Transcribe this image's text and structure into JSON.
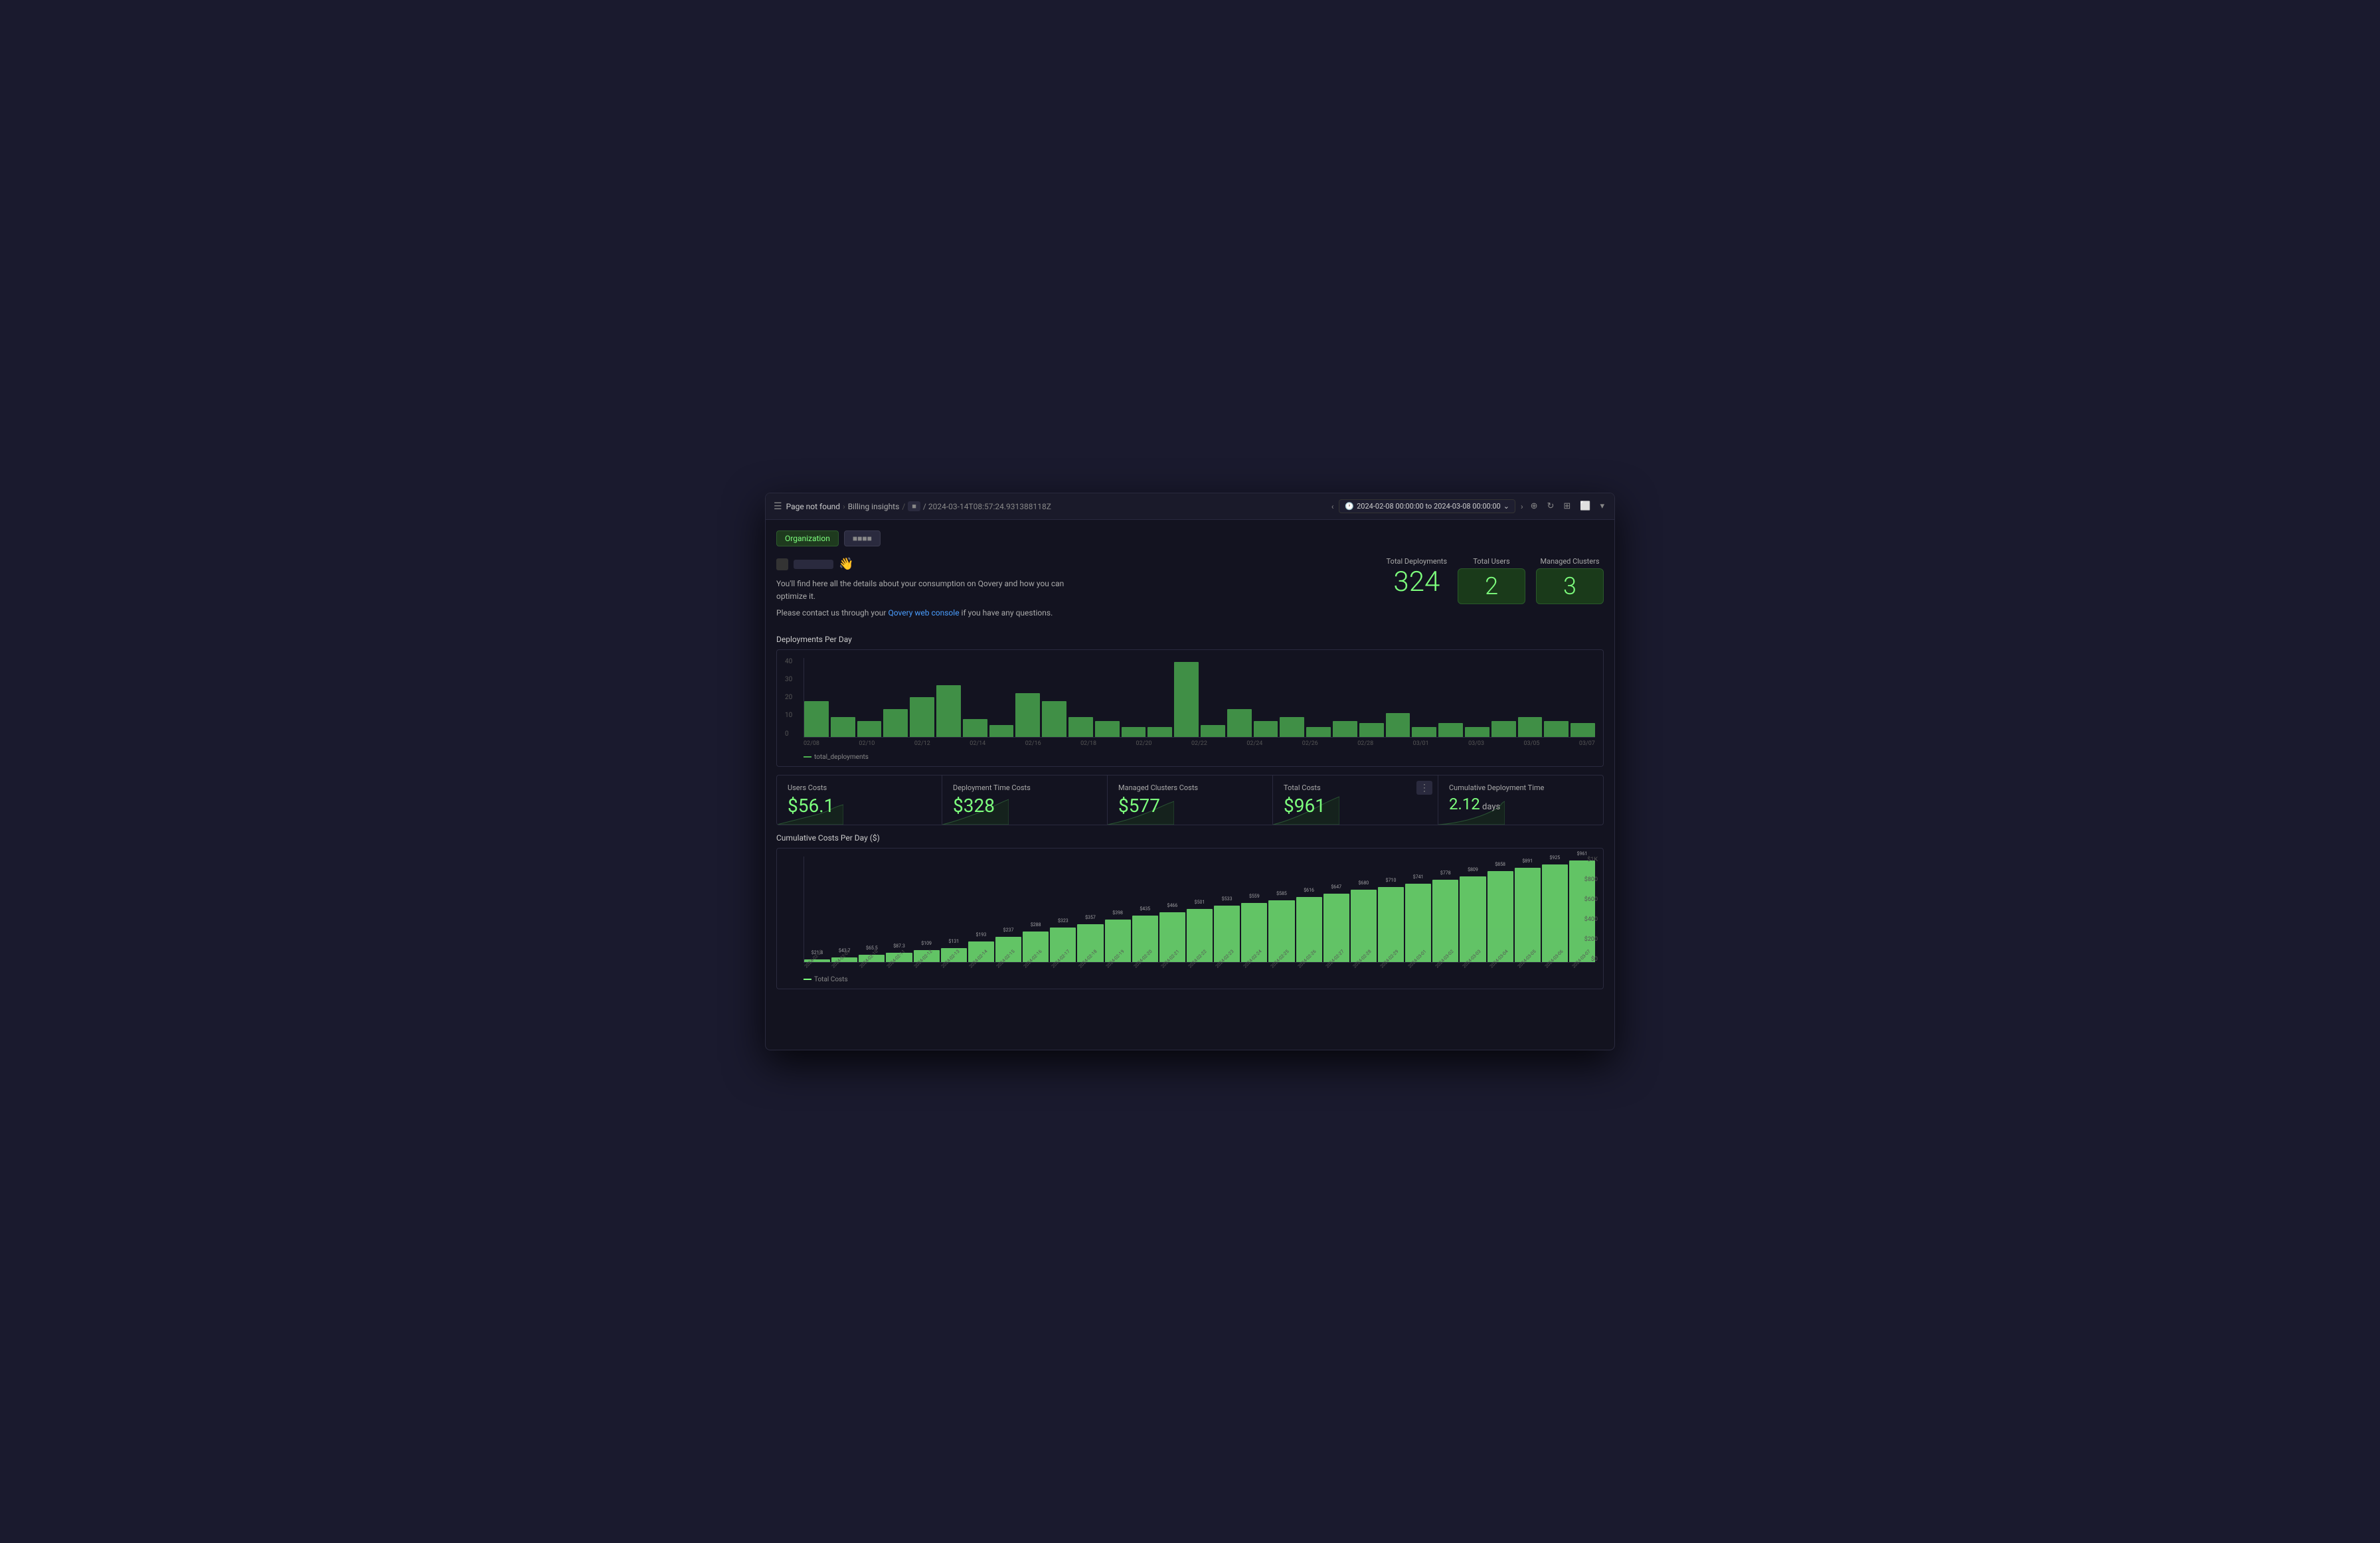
{
  "toolbar": {
    "hamburger_label": "☰",
    "breadcrumb": {
      "page": "Page not found",
      "sep1": "›",
      "billing": "Billing insights",
      "sep2": "/",
      "hash": "■",
      "path": "/ 2024-03-14T08:57:24.931388118Z"
    },
    "time_range": "2024-02-08 00:00:00 to 2024-03-08 00:00:00",
    "nav_prev": "‹",
    "nav_next": "›",
    "zoom_icon": "⊕",
    "refresh_icon": "↻",
    "expand_icon": "⊞",
    "dropdown_icon": "▾",
    "monitor_icon": "⬜",
    "more_icon": "⌄"
  },
  "tabs": [
    {
      "label": "Organization",
      "active": true
    },
    {
      "label": "■■■■",
      "active": false
    }
  ],
  "org": {
    "emoji": "👋",
    "description": "You'll find here all the details about your consumption on Qovery and how you can optimize it.",
    "contact_text": "Please contact us through your",
    "link_text": "Qovery web console",
    "link_suffix": " if you have any questions."
  },
  "stats": {
    "total_deployments": {
      "label": "Total Deployments",
      "value": "324"
    },
    "total_users": {
      "label": "Total Users",
      "value": "2"
    },
    "managed_clusters": {
      "label": "Managed Clusters",
      "value": "3"
    }
  },
  "deployments_chart": {
    "title": "Deployments Per Day",
    "y_labels": [
      "40",
      "30",
      "20",
      "10",
      "0"
    ],
    "x_labels": [
      "02/08",
      "02/10",
      "02/12",
      "02/14",
      "02/16",
      "02/18",
      "02/20",
      "02/22",
      "02/24",
      "02/26",
      "02/28",
      "03/01",
      "03/03",
      "03/05",
      "03/07"
    ],
    "legend": "total_deployments",
    "bars": [
      18,
      10,
      8,
      14,
      20,
      26,
      9,
      6,
      22,
      18,
      10,
      8,
      5,
      5,
      38,
      6,
      14,
      8,
      10,
      5,
      8,
      7,
      12,
      5,
      7,
      5,
      8,
      10,
      8,
      7
    ]
  },
  "costs": {
    "users": {
      "label": "Users Costs",
      "value": "$56.1"
    },
    "deployment_time": {
      "label": "Deployment Time Costs",
      "value": "$328"
    },
    "managed_clusters": {
      "label": "Managed Clusters Costs",
      "value": "$577"
    },
    "total": {
      "label": "Total Costs",
      "value": "$961"
    },
    "cumulative_deployment": {
      "label": "Cumulative Deployment Time",
      "value": "2.12",
      "unit": " days"
    }
  },
  "more_button_label": "⋮",
  "cumulative_chart": {
    "title": "Cumulative Costs Per Day ($)",
    "y_labels": [
      "$1K",
      "$800",
      "$600",
      "$400",
      "$200",
      "$0"
    ],
    "x_labels": [
      "2024-02-08",
      "2024-02-09",
      "2024-02-10",
      "2024-02-11",
      "2024-02-12",
      "2024-02-13",
      "2024-02-14",
      "2024-02-15",
      "2024-02-16",
      "2024-02-17",
      "2024-02-18",
      "2024-02-19",
      "2024-02-20",
      "2024-02-21",
      "2024-02-22",
      "2024-02-23",
      "2024-02-24",
      "2024-02-25",
      "2024-02-26",
      "2024-02-27",
      "2024-02-28",
      "2024-02-29",
      "2024-03-01",
      "2024-03-02",
      "2024-03-03",
      "2024-03-04",
      "2024-03-05",
      "2024-03-06",
      "2024-03-07"
    ],
    "bar_values": [
      21.8,
      43.7,
      65.5,
      87.3,
      109,
      131,
      193,
      237,
      288,
      323,
      357,
      398,
      435,
      466,
      501,
      533,
      559,
      585,
      616,
      647,
      680,
      710,
      741,
      778,
      809,
      858,
      891,
      925,
      961
    ],
    "bar_labels": [
      "$21.8",
      "$43.7",
      "$65.5",
      "$87.3",
      "$109",
      "$131",
      "$193",
      "$237",
      "$288",
      "$323",
      "$357",
      "$398",
      "$435",
      "$466",
      "$501",
      "$533",
      "$559",
      "$585",
      "$616",
      "$647",
      "$680",
      "$710",
      "$741",
      "$778",
      "$809",
      "$858",
      "$891",
      "$925",
      "$961"
    ],
    "legend": "Total Costs"
  }
}
